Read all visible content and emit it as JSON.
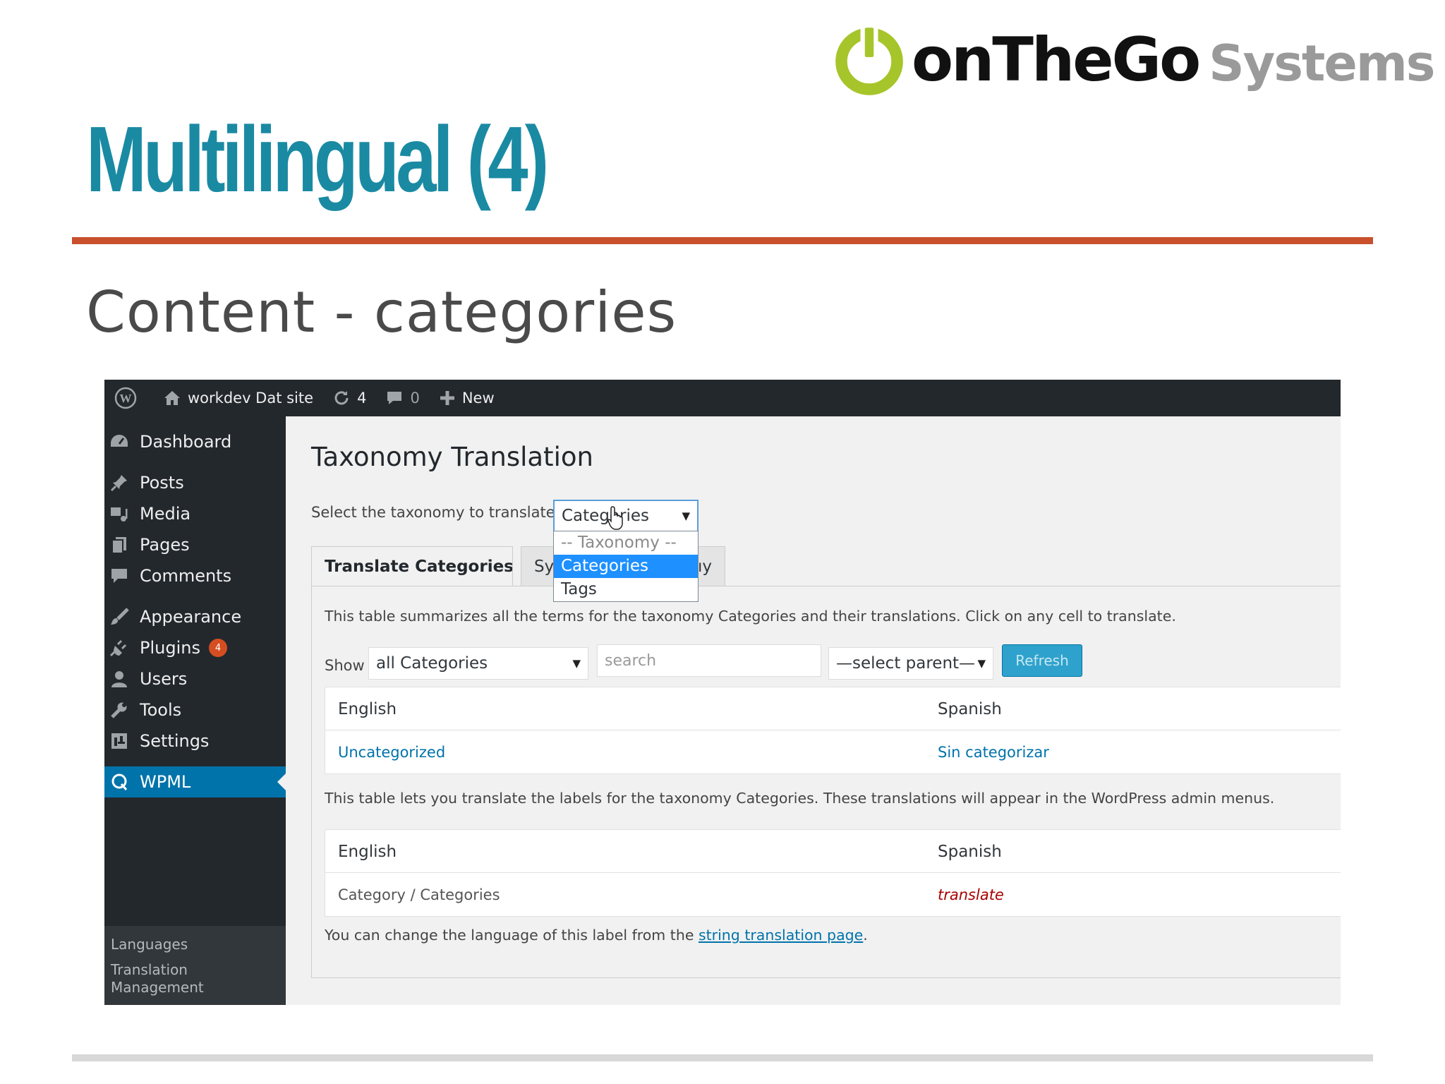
{
  "slide": {
    "logo": {
      "brand_on": "onTheGo",
      "brand_systems": "Systems"
    },
    "title": "Multilingual (4)",
    "subtitle": "Content - categories"
  },
  "colors": {
    "title": "#1a8aa3",
    "title_rule": "#c8502d",
    "logo_green": "#a6c52a",
    "wp_dark": "#23282d",
    "wp_blue": "#0073aa",
    "badge": "#d54e21"
  },
  "admin_bar": {
    "site_name": "workdev Dat site",
    "updates_count": "4",
    "comments_count": "0",
    "new_label": "New",
    "icons": [
      "wordpress-icon",
      "home-icon",
      "refresh-icon",
      "comment-icon",
      "plus-icon"
    ]
  },
  "sidebar": {
    "items": [
      {
        "label": "Dashboard",
        "icon": "dashboard-icon"
      },
      {
        "label": "Posts",
        "icon": "pin-icon"
      },
      {
        "label": "Media",
        "icon": "media-icon"
      },
      {
        "label": "Pages",
        "icon": "pages-icon"
      },
      {
        "label": "Comments",
        "icon": "comment-icon"
      },
      {
        "label": "Appearance",
        "icon": "brush-icon"
      },
      {
        "label": "Plugins",
        "icon": "plugin-icon",
        "badge": "4"
      },
      {
        "label": "Users",
        "icon": "user-icon"
      },
      {
        "label": "Tools",
        "icon": "wrench-icon"
      },
      {
        "label": "Settings",
        "icon": "settings-icon"
      },
      {
        "label": "WPML",
        "icon": "wpml-icon",
        "active": true
      }
    ],
    "submenu": [
      "Languages",
      "Translation Management"
    ]
  },
  "main": {
    "page_title": "Taxonomy Translation",
    "taxonomy_label": "Select the taxonomy to translate:",
    "taxonomy_select": {
      "value": "Categories",
      "options": [
        "-- Taxonomy --",
        "Categories",
        "Tags"
      ],
      "selected_index": 1
    },
    "tabs": [
      {
        "label": "Translate Categories",
        "active": true
      },
      {
        "label": "Sync Taxonomy",
        "visible_prefix": "Sy",
        "visible_suffix": "ıy"
      }
    ],
    "terms_desc": "This table summarizes all the terms for the taxonomy Categories and their translations. Click on any cell to translate.",
    "filter": {
      "show_label": "Show",
      "show_value": "all Categories",
      "search_placeholder": "search",
      "parent_value": "—select parent—",
      "refresh_label": "Refresh"
    },
    "terms_table": {
      "headers": [
        "English",
        "Spanish"
      ],
      "rows": [
        [
          "Uncategorized",
          "Sin categorizar"
        ]
      ]
    },
    "labels_desc": "This table lets you translate the labels for the taxonomy Categories. These translations will appear in the WordPress admin menus.",
    "labels_table": {
      "headers": [
        "English",
        "Spanish"
      ],
      "rows": [
        [
          "Category / Categories",
          "translate"
        ]
      ]
    },
    "footer_note": {
      "text": "You can change the language of this label from the ",
      "link": "string translation page",
      "end": "."
    }
  }
}
